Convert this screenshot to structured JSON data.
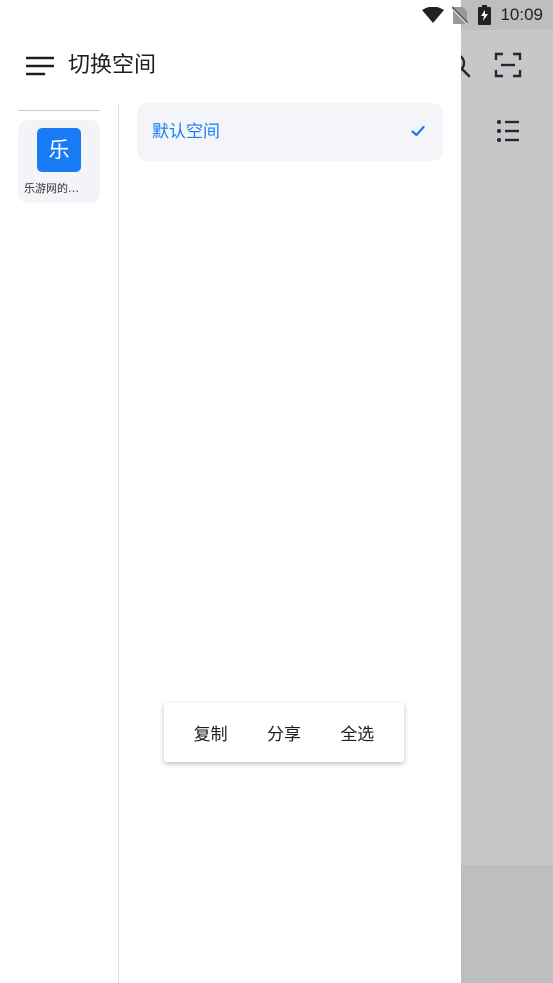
{
  "status_bar": {
    "time": "10:09",
    "icons": [
      "wifi-icon",
      "no-sim-icon",
      "battery-charging-icon"
    ]
  },
  "drawer": {
    "title": "切换空间",
    "menu_icon": "menu-icon"
  },
  "rail": {
    "spaces": [
      {
        "avatar_text": "乐",
        "label": "乐游网的…",
        "avatar_color": "#1a7cf5"
      }
    ]
  },
  "space_list": {
    "items": [
      {
        "label": "默认空间",
        "selected": true
      }
    ],
    "accent_color": "#1a7cf5"
  },
  "context_menu": {
    "items": [
      "复制",
      "分享",
      "全选"
    ]
  },
  "background_app": {
    "icons": [
      "search-icon",
      "scan-icon",
      "list-icon"
    ]
  }
}
